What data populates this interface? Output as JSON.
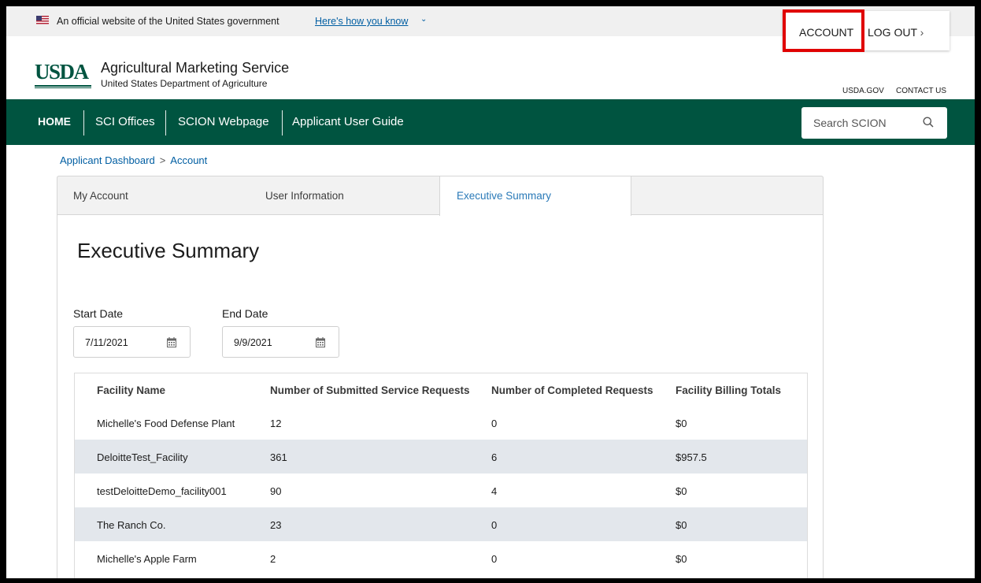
{
  "gov_banner": {
    "text": "An official website of the United States government",
    "link": "Here's how you know",
    "chevron": "⌄"
  },
  "account_menu": {
    "account": "ACCOUNT",
    "logout": "LOG OUT",
    "logout_chevron": "›"
  },
  "header": {
    "logo": "USDA",
    "agency": "Agricultural Marketing Service",
    "department": "United States Department of Agriculture",
    "utility_links": [
      "USDA.GOV",
      "CONTACT US"
    ]
  },
  "nav": {
    "items": [
      "HOME",
      "SCI Offices",
      "SCION Webpage",
      "Applicant User Guide"
    ],
    "search_placeholder": "Search SCION"
  },
  "breadcrumb": {
    "items": [
      "Applicant Dashboard",
      "Account"
    ],
    "separator": ">"
  },
  "tabs": {
    "items": [
      "My Account",
      "User Information",
      "Executive Summary"
    ],
    "active": "Executive Summary"
  },
  "main": {
    "title": "Executive Summary",
    "start_date_label": "Start Date",
    "start_date_value": "7/11/2021",
    "end_date_label": "End Date",
    "end_date_value": "9/9/2021"
  },
  "table": {
    "columns": [
      "Facility Name",
      "Number of Submitted Service Requests",
      "Number of Completed Requests",
      "Facility Billing Totals"
    ],
    "rows": [
      [
        "Michelle's Food Defense Plant",
        "12",
        "0",
        "$0"
      ],
      [
        "DeloitteTest_Facility",
        "361",
        "6",
        "$957.5"
      ],
      [
        "testDeloitteDemo_facility001",
        "90",
        "4",
        "$0"
      ],
      [
        "The Ranch Co.",
        "23",
        "0",
        "$0"
      ],
      [
        "Michelle's Apple Farm",
        "2",
        "0",
        "$0"
      ]
    ]
  },
  "colors": {
    "nav_bg": "#005440",
    "link": "#005ea2",
    "highlight": "#e00000",
    "row_alt": "#e3e7ec"
  }
}
